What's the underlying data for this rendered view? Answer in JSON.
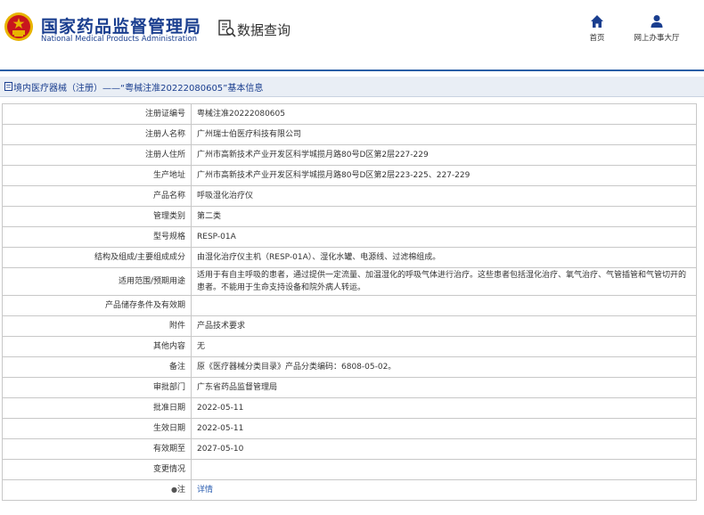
{
  "header": {
    "logo_cn": "国家药品监督管理局",
    "logo_en": "National Medical Products Administration",
    "query_label": "数据查询",
    "nav": [
      {
        "label": "首页",
        "icon": "home-icon"
      },
      {
        "label": "网上办事大厅",
        "icon": "user-icon"
      }
    ]
  },
  "page_title": "境内医疗器械（注册）——“粤械注准20222080605”基本信息",
  "colors": {
    "brand": "#1a3e8f",
    "divider": "#2b5fa6",
    "titlebar_bg": "#e9eef5",
    "link": "#2a5db0",
    "emblem_red": "#c8161d",
    "emblem_gold": "#e8b400"
  },
  "rows": [
    {
      "label": "注册证编号",
      "value": "粤械注准20222080605"
    },
    {
      "label": "注册人名称",
      "value": "广州瑞士伯医疗科技有限公司"
    },
    {
      "label": "注册人住所",
      "value": "广州市高新技术产业开发区科学城揽月路80号D区第2层227-229"
    },
    {
      "label": "生产地址",
      "value": "广州市高新技术产业开发区科学城揽月路80号D区第2层223-225、227-229"
    },
    {
      "label": "产品名称",
      "value": "呼吸湿化治疗仪"
    },
    {
      "label": "管理类别",
      "value": "第二类"
    },
    {
      "label": "型号规格",
      "value": "RESP-01A"
    },
    {
      "label": "结构及组成/主要组成成分",
      "value": "由湿化治疗仪主机（RESP-01A）、湿化水罐、电源线、过滤棉组成。"
    },
    {
      "label": "适用范围/预期用途",
      "value": "适用于有自主呼吸的患者，通过提供一定流量、加温湿化的呼吸气体进行治疗。这些患者包括湿化治疗、氧气治疗、气管插管和气管切开的患者。不能用于生命支持设备和院外病人转运。"
    },
    {
      "label": "产品储存条件及有效期",
      "value": ""
    },
    {
      "label": "附件",
      "value": "产品技术要求"
    },
    {
      "label": "其他内容",
      "value": "无"
    },
    {
      "label": "备注",
      "value": "原《医疗器械分类目录》产品分类编码：6808-05-02。"
    },
    {
      "label": "审批部门",
      "value": "广东省药品监督管理局"
    },
    {
      "label": "批准日期",
      "value": "2022-05-11"
    },
    {
      "label": "生效日期",
      "value": "2022-05-11"
    },
    {
      "label": "有效期至",
      "value": "2027-05-10"
    },
    {
      "label": "变更情况",
      "value": ""
    },
    {
      "label": "注",
      "value": "详情"
    }
  ]
}
